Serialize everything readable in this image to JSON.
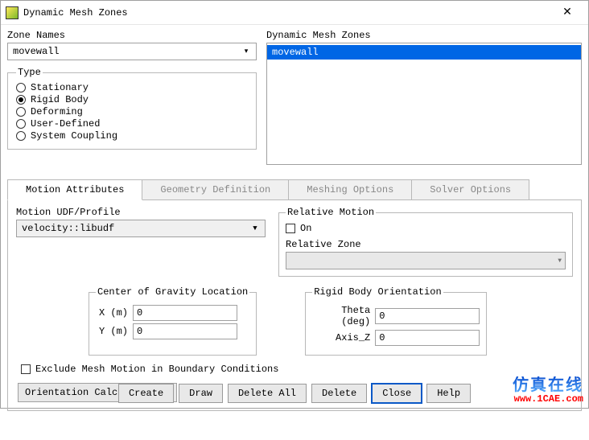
{
  "window": {
    "title": "Dynamic Mesh Zones"
  },
  "zoneNames": {
    "label": "Zone Names",
    "value": "movewall"
  },
  "type": {
    "legend": "Type",
    "options": [
      "Stationary",
      "Rigid Body",
      "Deforming",
      "User-Defined",
      "System Coupling"
    ],
    "selected": 1
  },
  "dmz": {
    "label": "Dynamic Mesh Zones",
    "items": [
      "movewall"
    ],
    "selected": 0
  },
  "tabs": {
    "items": [
      "Motion Attributes",
      "Geometry Definition",
      "Meshing Options",
      "Solver Options"
    ],
    "active": 0
  },
  "motion": {
    "udf": {
      "label": "Motion UDF/Profile",
      "value": "velocity::libudf"
    },
    "relative": {
      "legend": "Relative Motion",
      "on_label": "On",
      "zone_label": "Relative Zone"
    },
    "cg": {
      "legend": "Center of Gravity Location",
      "fields": [
        {
          "label": "X (m)",
          "value": "0"
        },
        {
          "label": "Y (m)",
          "value": "0"
        }
      ]
    },
    "rbo": {
      "legend": "Rigid Body Orientation",
      "fields": [
        {
          "label": "Theta (deg)",
          "value": "0"
        },
        {
          "label": "Axis_Z",
          "value": "0"
        }
      ]
    },
    "exclude_label": "Exclude Mesh Motion in Boundary Conditions",
    "orientation_btn": "Orientation Calculator..."
  },
  "footer": {
    "buttons": [
      "Create",
      "Draw",
      "Delete All",
      "Delete",
      "Close",
      "Help"
    ],
    "primary": 4
  },
  "branding": {
    "cn": "仿真在线",
    "url": "www.1CAE.com"
  }
}
